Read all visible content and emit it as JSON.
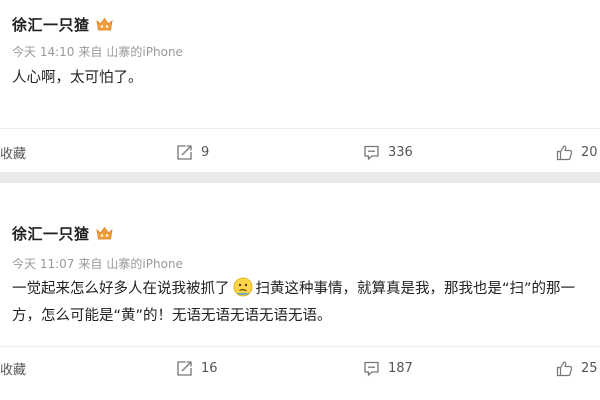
{
  "posts": [
    {
      "author": "徐汇一只猹",
      "meta": {
        "time": "今天 14:10",
        "source_prefix": "来自",
        "source": "山寨的iPhone"
      },
      "content_before_emoji": "人心啊，太可怕了。",
      "content_after_emoji": "",
      "has_emoji": false,
      "actions": {
        "favorite": "收藏",
        "repost_count": "9",
        "comment_count": "336",
        "like_count": "20"
      }
    },
    {
      "author": "徐汇一只猹",
      "meta": {
        "time": "今天 11:07",
        "source_prefix": "来自",
        "source": "山寨的iPhone"
      },
      "content_before_emoji": "一觉起来怎么好多人在说我被抓了",
      "content_after_emoji": "扫黄这种事情，就算真是我，那我也是“扫”的那一方，怎么可能是“黄”的！无语无语无语无语无语。",
      "has_emoji": true,
      "emoji_name": "confused-face-emoji",
      "actions": {
        "favorite": "收藏",
        "repost_count": "16",
        "comment_count": "187",
        "like_count": "25"
      }
    }
  ],
  "icons": {
    "badge": "vip-badge-icon",
    "repost": "repost-icon",
    "comment": "comment-icon",
    "like": "thumbs-up-icon"
  },
  "colors": {
    "background": "#e9eaec",
    "text": "#222222",
    "meta": "#9a9a9a",
    "badge": "#f2a03d"
  }
}
